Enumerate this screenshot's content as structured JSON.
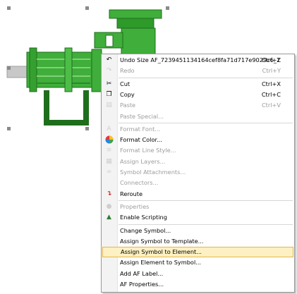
{
  "context_menu": {
    "items": [
      {
        "label": "Undo  Size AF_7239451134164cef8fa71d717e9029c6_1",
        "shortcut": "Ctrl+Z",
        "icon": "undo-icon",
        "enabled": true
      },
      {
        "label": "Redo",
        "shortcut": "Ctrl+Y",
        "icon": "redo-icon",
        "enabled": false
      },
      {
        "label": "Cut",
        "shortcut": "Ctrl+X",
        "icon": "cut-icon",
        "enabled": true
      },
      {
        "label": "Copy",
        "shortcut": "Ctrl+C",
        "icon": "copy-icon",
        "enabled": true
      },
      {
        "label": "Paste",
        "shortcut": "Ctrl+V",
        "icon": "paste-icon",
        "enabled": false
      },
      {
        "label": "Paste Special...",
        "shortcut": "",
        "icon": "",
        "enabled": false
      },
      {
        "label": "Format Font...",
        "shortcut": "",
        "icon": "font-icon",
        "enabled": false
      },
      {
        "label": "Format Color...",
        "shortcut": "",
        "icon": "color-wheel-icon",
        "enabled": true
      },
      {
        "label": "Format Line Style...",
        "shortcut": "",
        "icon": "line-style-icon",
        "enabled": false
      },
      {
        "label": "Assign Layers...",
        "shortcut": "",
        "icon": "layers-icon",
        "enabled": false
      },
      {
        "label": "Symbol Attachments...",
        "shortcut": "",
        "icon": "attachment-icon",
        "enabled": false
      },
      {
        "label": "Connectors...",
        "shortcut": "",
        "icon": "",
        "enabled": false
      },
      {
        "label": "Reroute",
        "shortcut": "",
        "icon": "reroute-icon",
        "enabled": true
      },
      {
        "label": "Properties",
        "shortcut": "",
        "icon": "properties-icon",
        "enabled": false
      },
      {
        "label": "Enable Scripting",
        "shortcut": "",
        "icon": "scripting-icon",
        "enabled": true
      },
      {
        "label": "Change Symbol...",
        "shortcut": "",
        "icon": "",
        "enabled": true
      },
      {
        "label": "Assign Symbol to Template...",
        "shortcut": "",
        "icon": "",
        "enabled": true
      },
      {
        "label": "Assign Symbol to Element...",
        "shortcut": "",
        "icon": "",
        "enabled": true,
        "highlighted": true
      },
      {
        "label": "Assign Element to Symbol...",
        "shortcut": "",
        "icon": "",
        "enabled": true
      },
      {
        "label": "Add AF Label...",
        "shortcut": "",
        "icon": "",
        "enabled": true
      },
      {
        "label": "AF Properties...",
        "shortcut": "",
        "icon": "",
        "enabled": true
      }
    ]
  },
  "colors": {
    "pump_green": "#3fae3a",
    "pump_dark": "#1f6e1c",
    "highlight_bg": "#fdf0c2",
    "highlight_border": "#e2b84a"
  }
}
